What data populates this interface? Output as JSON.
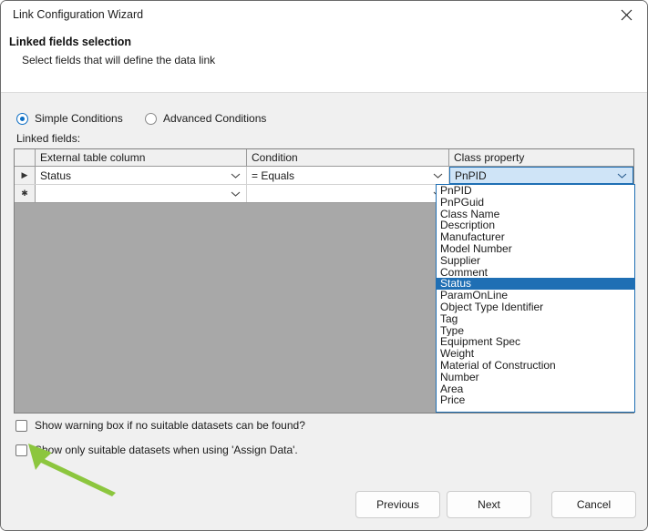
{
  "window": {
    "title": "Link Configuration Wizard",
    "close_icon": "close-icon"
  },
  "header": {
    "title": "Linked fields selection",
    "subtitle": "Select fields that will define the data link"
  },
  "conditions": {
    "simple_label": "Simple Conditions",
    "advanced_label": "Advanced Conditions",
    "selected": "Simple Conditions"
  },
  "grid": {
    "caption": "Linked fields:",
    "columns": [
      "External table column",
      "Condition",
      "Class property"
    ],
    "row_marker_current": "▶",
    "row_marker_new": "✱",
    "rows": [
      {
        "marker": "▶",
        "external_table_column": "Status",
        "condition": "= Equals",
        "class_property": "PnPID",
        "class_property_selected": true
      },
      {
        "marker": "✱",
        "external_table_column": "",
        "condition": "",
        "class_property": "",
        "class_property_selected": false
      }
    ]
  },
  "dropdown": {
    "open": true,
    "highlighted": "Status",
    "options": [
      "PnPID",
      "PnPGuid",
      "Class Name",
      "Description",
      "Manufacturer",
      "Model Number",
      "Supplier",
      "Comment",
      "Status",
      "ParamOnLine",
      "Object Type Identifier",
      "Tag",
      "Type",
      "Equipment Spec",
      "Weight",
      "Material of Construction",
      "Number",
      "Area",
      "Price"
    ]
  },
  "checkboxes": [
    {
      "label": "Show warning box if no suitable datasets can be found?",
      "checked": false
    },
    {
      "label": "Show only suitable datasets when using 'Assign Data'.",
      "checked": false
    }
  ],
  "footer": {
    "previous_label": "Previous",
    "next_label": "Next",
    "cancel_label": "Cancel"
  },
  "annotation": {
    "arrow_color": "#8CC63E",
    "points_to": "Show only suitable datasets when using 'Assign Data'."
  }
}
